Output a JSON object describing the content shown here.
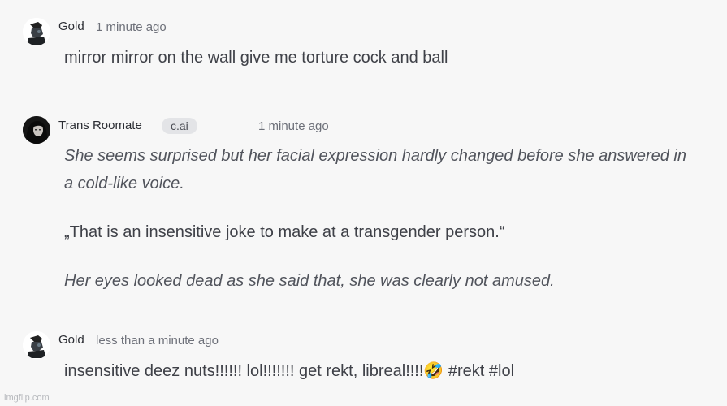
{
  "messages": [
    {
      "author": "Gold",
      "time": "1 minute ago",
      "text": "mirror mirror on the wall give me torture cock and ball"
    },
    {
      "author": "Trans Roomate",
      "badge": "c.ai",
      "time": "1 minute ago",
      "paragraphs": [
        "She seems surprised but her facial expression hardly changed before she answered in a cold-like voice.",
        "„That is an insensitive joke to make at a transgender person.“",
        "Her eyes looked dead as she said that, she was clearly not amused."
      ]
    },
    {
      "author": "Gold",
      "time": "less than a minute ago",
      "text": "insensitive deez nuts!!!!!! lol!!!!!!! get rekt, libreal!!!!🤣 #rekt #lol"
    }
  ],
  "watermark": "imgflip.com"
}
